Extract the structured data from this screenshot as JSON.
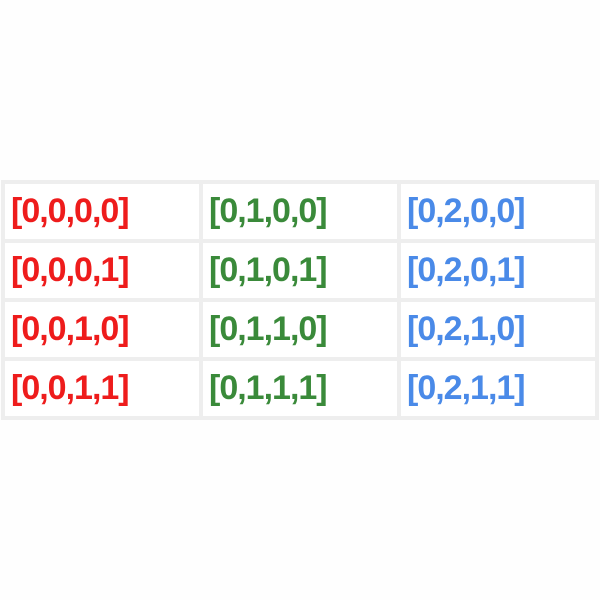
{
  "grid": {
    "rows": [
      {
        "cells": [
          "[0,0,0,0]",
          "[0,1,0,0]",
          "[0,2,0,0]"
        ]
      },
      {
        "cells": [
          "[0,0,0,1]",
          "[0,1,0,1]",
          "[0,2,0,1]"
        ]
      },
      {
        "cells": [
          "[0,0,1,0]",
          "[0,1,1,0]",
          "[0,2,1,0]"
        ]
      },
      {
        "cells": [
          "[0,0,1,1]",
          "[0,1,1,1]",
          "[0,2,1,1]"
        ]
      }
    ],
    "column_colors": [
      "#ee1c1c",
      "#3a8a3a",
      "#4a8ae8"
    ]
  }
}
